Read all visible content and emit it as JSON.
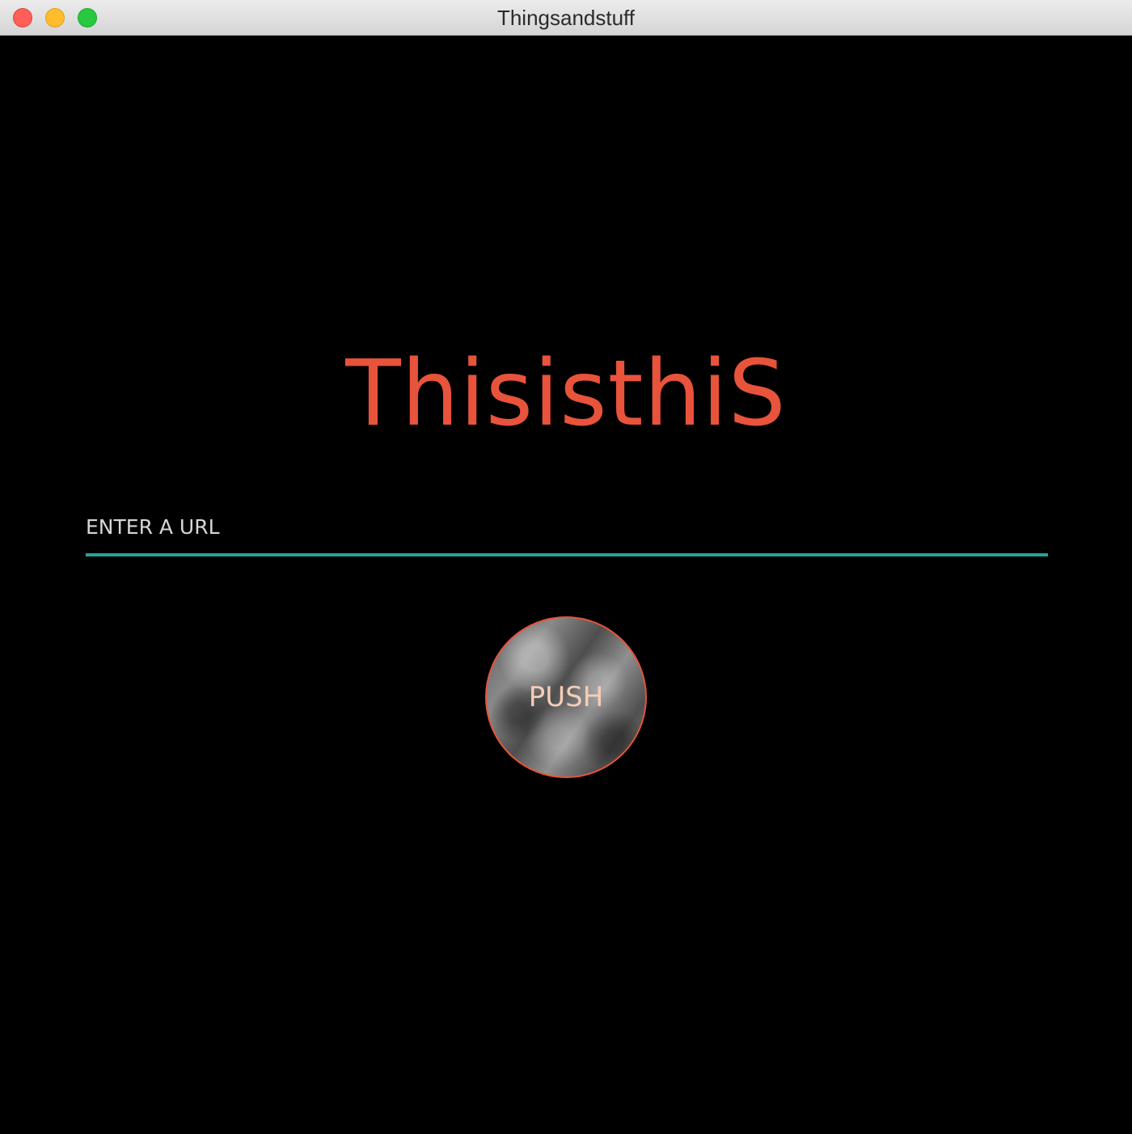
{
  "window": {
    "title": "Thingsandstuff"
  },
  "main": {
    "headline": "ThisisthiS",
    "url_input": {
      "placeholder": "ENTER A URL",
      "value": ""
    },
    "push_button_label": "PUSH"
  },
  "colors": {
    "background": "#000000",
    "headline": "#e8533b",
    "input_underline": "#2aa198",
    "button_border": "#e8533b",
    "button_label": "#f6cdb6"
  }
}
